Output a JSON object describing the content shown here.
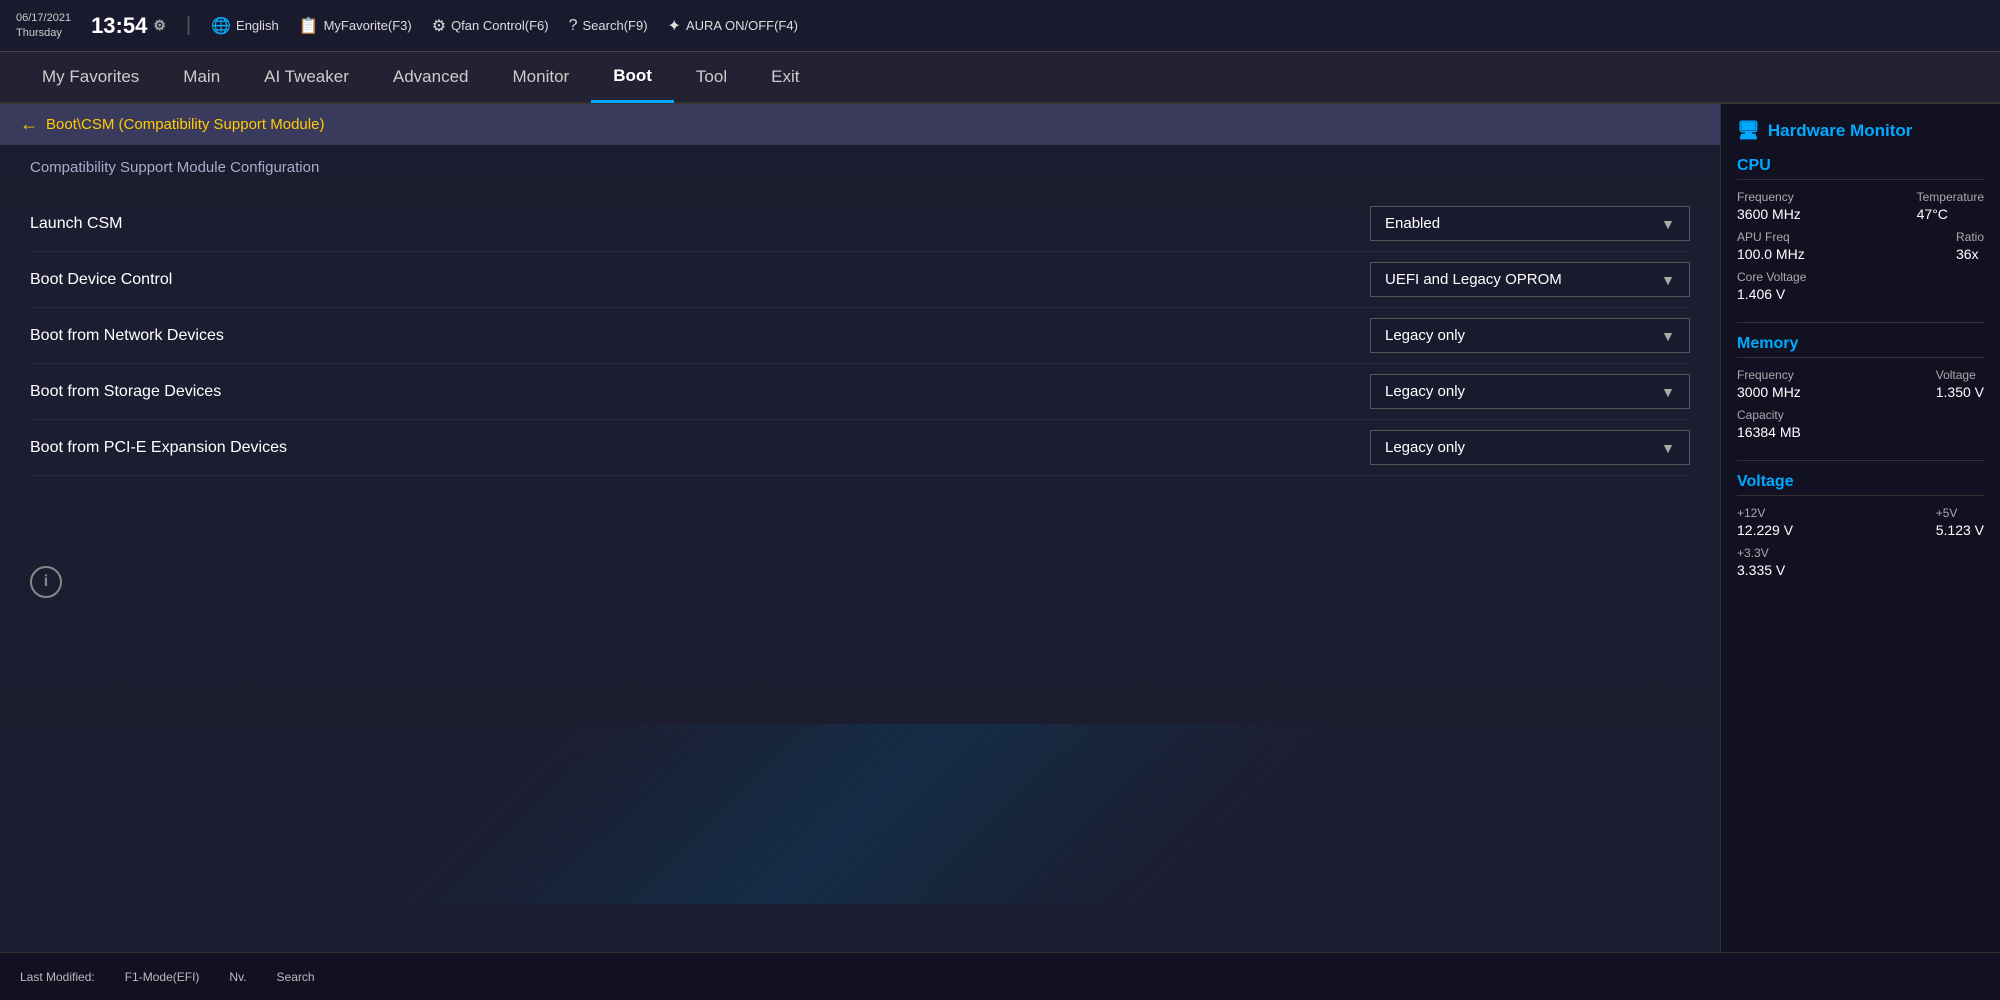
{
  "topbar": {
    "date": "06/17/2021",
    "day": "Thursday",
    "time": "13:54",
    "gear_symbol": "⚙",
    "divider": "|",
    "items": [
      {
        "icon": "🌐",
        "label": "English"
      },
      {
        "icon": "📋",
        "label": "MyFavorite(F3)"
      },
      {
        "icon": "⚙",
        "label": "Qfan Control(F6)"
      },
      {
        "icon": "?",
        "label": "Search(F9)"
      },
      {
        "icon": "✦",
        "label": "AURA ON/OFF(F4)"
      }
    ]
  },
  "nav": {
    "items": [
      {
        "id": "my-favorites",
        "label": "My Favorites",
        "active": false
      },
      {
        "id": "main",
        "label": "Main",
        "active": false
      },
      {
        "id": "ai-tweaker",
        "label": "AI Tweaker",
        "active": false
      },
      {
        "id": "advanced",
        "label": "Advanced",
        "active": false
      },
      {
        "id": "monitor",
        "label": "Monitor",
        "active": false
      },
      {
        "id": "boot",
        "label": "Boot",
        "active": true
      },
      {
        "id": "tool",
        "label": "Tool",
        "active": false
      },
      {
        "id": "exit",
        "label": "Exit",
        "active": false
      }
    ]
  },
  "breadcrumb": {
    "arrow": "←",
    "path": "Boot\\CSM (Compatibility Support Module)"
  },
  "section": {
    "title": "Compatibility Support Module Configuration",
    "settings": [
      {
        "id": "launch-csm",
        "label": "Launch CSM",
        "value": "Enabled"
      },
      {
        "id": "boot-device-control",
        "label": "Boot Device Control",
        "value": "UEFI and Legacy OPROM"
      },
      {
        "id": "boot-from-network",
        "label": "Boot from Network Devices",
        "value": "Legacy only"
      },
      {
        "id": "boot-from-storage",
        "label": "Boot from Storage Devices",
        "value": "Legacy only"
      },
      {
        "id": "boot-from-pcie",
        "label": "Boot from PCI-E Expansion Devices",
        "value": "Legacy only"
      }
    ]
  },
  "sidebar": {
    "title": "Hardware Monitor",
    "icon": "🖥",
    "sections": [
      {
        "id": "cpu",
        "title": "CPU",
        "rows": [
          {
            "cols": [
              {
                "label": "Frequency",
                "value": "3600 MHz"
              },
              {
                "label": "Temperature",
                "value": "47°C"
              }
            ]
          },
          {
            "cols": [
              {
                "label": "APU Freq",
                "value": "100.0 MHz"
              },
              {
                "label": "Ratio",
                "value": "36x"
              }
            ]
          },
          {
            "cols": [
              {
                "label": "Core Voltage",
                "value": "1.406 V"
              }
            ]
          }
        ]
      },
      {
        "id": "memory",
        "title": "Memory",
        "rows": [
          {
            "cols": [
              {
                "label": "Frequency",
                "value": "3000 MHz"
              },
              {
                "label": "Voltage",
                "value": "1.350 V"
              }
            ]
          },
          {
            "cols": [
              {
                "label": "Capacity",
                "value": "16384 MB"
              }
            ]
          }
        ]
      },
      {
        "id": "voltage",
        "title": "Voltage",
        "rows": [
          {
            "cols": [
              {
                "label": "+12V",
                "value": "12.229 V"
              },
              {
                "label": "+5V",
                "value": "5.123 V"
              }
            ]
          },
          {
            "cols": [
              {
                "label": "+3.3V",
                "value": "3.335 V"
              }
            ]
          }
        ]
      }
    ]
  },
  "bottom": {
    "items": [
      {
        "label": "Last Modified:"
      },
      {
        "label": "F1-Mode(EFI)"
      },
      {
        "label": "Nv."
      },
      {
        "label": "Search"
      }
    ]
  }
}
